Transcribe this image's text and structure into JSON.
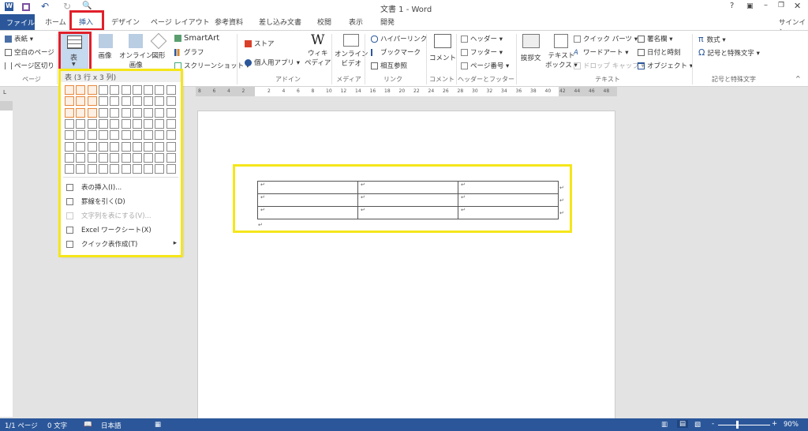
{
  "window": {
    "title": "文書 1 - Word",
    "help": "?",
    "signin": "サインイン"
  },
  "qat": {
    "undo": "↶",
    "redo": "↻"
  },
  "tabs": [
    "ファイル",
    "ホーム",
    "挿入",
    "デザイン",
    "ページ レイアウト",
    "参考資料",
    "差し込み文書",
    "校閲",
    "表示",
    "開発"
  ],
  "ribbon": {
    "page": {
      "items": [
        "表紙 ▾",
        "空白のページ",
        "ページ区切り"
      ],
      "label": "ページ"
    },
    "table": {
      "label": "表"
    },
    "illust": {
      "picture": "画像",
      "online_picture": [
        "オンライン",
        "画像"
      ],
      "shapes": "図形",
      "smartart": "SmartArt",
      "chart": "グラフ",
      "screenshot": "スクリーンショット ▾"
    },
    "addins": {
      "store": "ストア",
      "myapps": "個人用アプリ ▾",
      "wiki": [
        "ウィキ",
        "ペディア"
      ],
      "label": "アドイン"
    },
    "media": {
      "video": [
        "オンライン",
        "ビデオ"
      ],
      "label": "メディア"
    },
    "links": {
      "items": [
        "ハイパーリンク",
        "ブックマーク",
        "相互参照"
      ],
      "label": "リンク"
    },
    "comment": {
      "btn": "コメント",
      "label": "コメント"
    },
    "hf": {
      "items": [
        "ヘッダー ▾",
        "フッター ▾",
        "ページ番号 ▾"
      ],
      "label": "ヘッダーとフッター"
    },
    "text": {
      "greeting": "挨拶文",
      "textbox": [
        "テキスト",
        "ボックス ▾"
      ],
      "items": [
        "クイック パーツ ▾",
        "ワードアート ▾",
        "ドロップ キャップ ▾"
      ],
      "items2": [
        "署名欄 ▾",
        "日付と時刻",
        "オブジェクト ▾"
      ],
      "label": "テキスト"
    },
    "symbols": {
      "equation": "数式 ▾",
      "symbol": "記号と特殊文字 ▾",
      "label": "記号と特殊文字"
    }
  },
  "dropdown": {
    "header": "表 (3 行 x 3 列)",
    "rows": 8,
    "cols": 10,
    "selected_rows": 3,
    "selected_cols": 3,
    "items": [
      {
        "label": "表の挿入(I)...",
        "enabled": true
      },
      {
        "label": "罫線を引く(D)",
        "enabled": true
      },
      {
        "label": "文字列を表にする(V)...",
        "enabled": false
      },
      {
        "label": "Excel ワークシート(X)",
        "enabled": true
      },
      {
        "label": "クイック表作成(T)",
        "enabled": true,
        "submenu": true
      }
    ]
  },
  "ruler": {
    "left": [
      "8",
      "6",
      "4",
      "2"
    ],
    "right": [
      "2",
      "4",
      "6",
      "8",
      "10",
      "12",
      "14",
      "16",
      "18",
      "20",
      "22",
      "24",
      "26",
      "28",
      "30",
      "32",
      "34",
      "36",
      "38",
      "40",
      "42",
      "44",
      "46",
      "48"
    ]
  },
  "doc": {
    "mark": "↵"
  },
  "status": {
    "page": "1/1 ページ",
    "words": "0 文字",
    "lang": "日本語",
    "zoom": "90%"
  },
  "colors": {
    "accent": "#2b579a",
    "highlight_yellow": "#f5e61a",
    "highlight_red": "#e0202a"
  }
}
